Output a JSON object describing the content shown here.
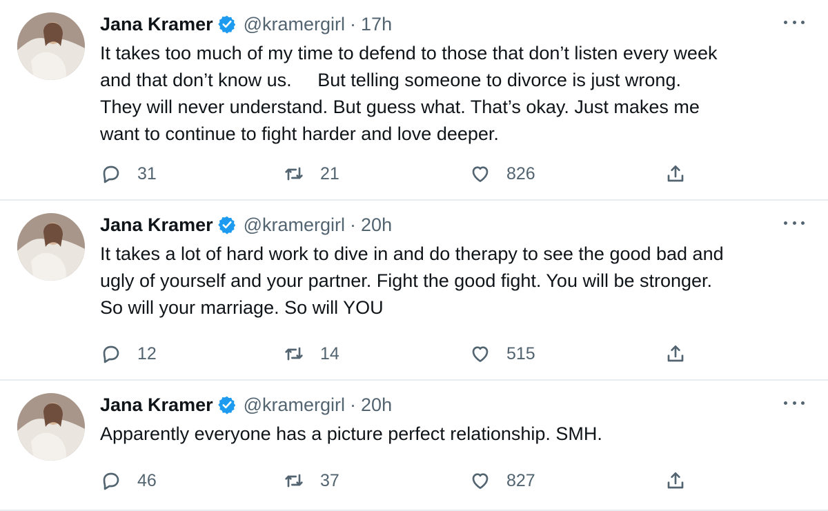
{
  "tweets": [
    {
      "author": "Jana Kramer",
      "handle": "@kramergirl",
      "separator": "·",
      "time": "17h",
      "text": "It takes too much of my time to defend to those that don’t listen every week\nand that don’t know us.     But telling someone to divorce is just wrong.\nThey will never understand. But guess what. That’s okay. Just makes me\nwant to continue to fight harder and love deeper.",
      "replies": "31",
      "retweets": "21",
      "likes": "826"
    },
    {
      "author": "Jana Kramer",
      "handle": "@kramergirl",
      "separator": "·",
      "time": "20h",
      "text": "It takes a lot of hard work to dive in and do therapy to see the good bad and\nugly of yourself and your partner. Fight the good fight. You will be stronger.\nSo will your marriage. So will YOU",
      "replies": "12",
      "retweets": "14",
      "likes": "515"
    },
    {
      "author": "Jana Kramer",
      "handle": "@kramergirl",
      "separator": "·",
      "time": "20h",
      "text": "Apparently everyone has a picture perfect relationship. SMH.",
      "replies": "46",
      "retweets": "37",
      "likes": "827"
    }
  ],
  "icons": {
    "verified": "verified-badge-icon",
    "more": "more-options-icon",
    "reply": "reply-icon",
    "retweet": "retweet-icon",
    "like": "heart-icon",
    "share": "share-icon"
  },
  "colors": {
    "text": "#0f1419",
    "secondary": "#536471",
    "verified": "#1d9bf0",
    "divider": "#e6ecf0"
  }
}
